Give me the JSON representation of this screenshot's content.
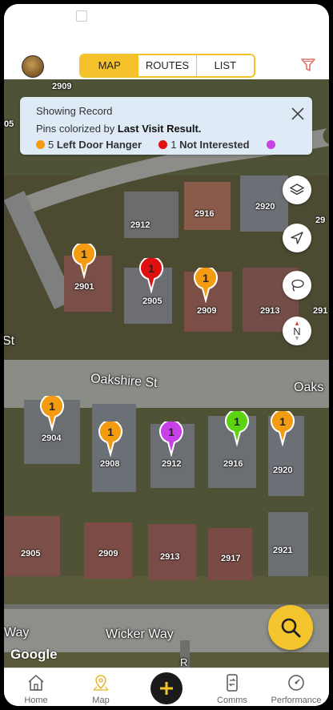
{
  "app": {
    "segments": [
      {
        "label": "MAP",
        "active": true
      },
      {
        "label": "ROUTES",
        "active": false
      },
      {
        "label": "LIST",
        "active": false
      }
    ]
  },
  "info_card": {
    "line1": "Showing Record",
    "line2_prefix": "Pins colorized by ",
    "line2_bold": "Last Visit Result.",
    "legend": [
      {
        "count": "5",
        "label": "Left Door Hanger",
        "color": "#f39c12"
      },
      {
        "count": "1",
        "label": "Not Interested",
        "color": "#e01010"
      },
      {
        "count": "",
        "label": "",
        "color": "#c740e8"
      }
    ]
  },
  "map": {
    "streets": [
      "St",
      "Oakshire St",
      "Oaks",
      "Way",
      "Wicker Way",
      "Wi",
      "R"
    ],
    "house_numbers": [
      "2909",
      "05",
      "2912",
      "2916",
      "2920",
      "29",
      "2901",
      "2905",
      "2909",
      "2913",
      "291",
      "2904",
      "2908",
      "2912",
      "2916",
      "2920",
      "2905",
      "2909",
      "2913",
      "2917",
      "2921"
    ],
    "pins": [
      {
        "count": "1",
        "color": "#f39c12"
      },
      {
        "count": "1",
        "color": "#e01010"
      },
      {
        "count": "1",
        "color": "#f39c12"
      },
      {
        "count": "1",
        "color": "#f39c12"
      },
      {
        "count": "1",
        "color": "#f39c12"
      },
      {
        "count": "1",
        "color": "#c740e8"
      },
      {
        "count": "1",
        "color": "#5bd312"
      },
      {
        "count": "1",
        "color": "#f39c12"
      }
    ],
    "compass_label": "N",
    "attribution": "Google"
  },
  "bottom_nav": {
    "home": "Home",
    "map": "Map",
    "comms": "Comms",
    "performance": "Performance"
  },
  "colors": {
    "accent": "#f5c22c",
    "map_active_icon": "#e6b422"
  }
}
